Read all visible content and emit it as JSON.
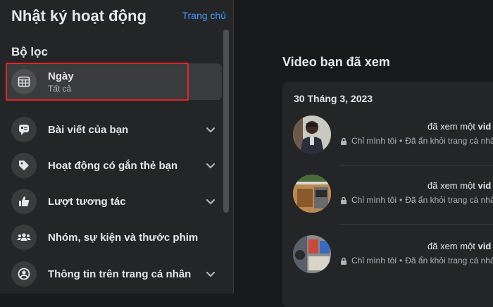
{
  "header": {
    "title": "Nhật ký hoạt động",
    "home_link": "Trang chủ"
  },
  "filters": {
    "heading": "Bộ lọc",
    "items": [
      {
        "label": "Ngày",
        "sublabel": "Tất cả",
        "icon": "calendar-icon"
      },
      {
        "label": "Bài viết của bạn",
        "icon": "post-icon"
      },
      {
        "label": "Hoạt động có gắn thẻ bạn",
        "icon": "tag-icon"
      },
      {
        "label": "Lượt tương tác",
        "icon": "like-icon"
      },
      {
        "label": "Nhóm, sự kiện và thước phim",
        "icon": "groups-icon"
      },
      {
        "label": "Thông tin trên trang cá nhân",
        "icon": "profile-icon"
      }
    ]
  },
  "main": {
    "title": "Video bạn đã xem",
    "date": "30 Tháng 3, 2023",
    "entries": [
      {
        "action": "đã xem một ",
        "action_bold": "vid",
        "privacy": "Chỉ mình tôi",
        "separator": "•",
        "status": "Đã ẩn khỏi trang cá nhâ"
      },
      {
        "action": "đã xem một ",
        "action_bold": "vid",
        "privacy": "Chỉ mình tôi",
        "separator": "•",
        "status": "Đã ẩn khỏi trang cá nhâ"
      },
      {
        "action": "đã xem một ",
        "action_bold": "vid",
        "privacy": "Chỉ mình tôi",
        "separator": "•",
        "status": "Đã ẩn khỏi trang cá nhâ"
      }
    ]
  },
  "colors": {
    "background": "#18191a",
    "panel": "#242526",
    "link": "#4599ff",
    "highlight_border": "#e0252a"
  }
}
